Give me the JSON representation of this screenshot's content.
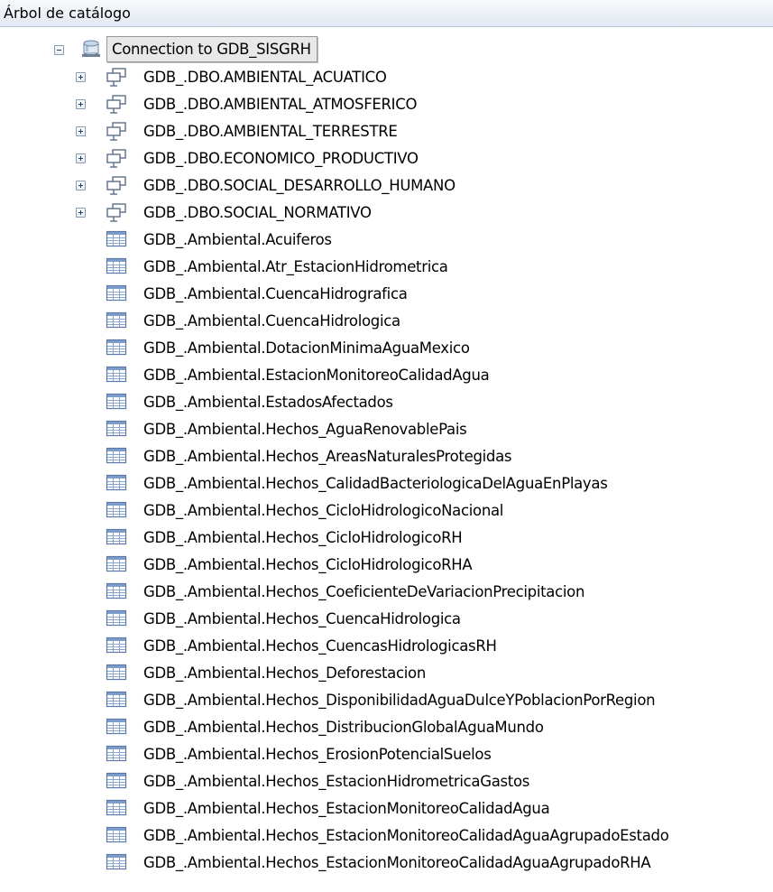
{
  "panel": {
    "title": "Árbol de catálogo"
  },
  "tree": {
    "root": {
      "label": "Connection to GDB_SISGRH",
      "icon": "database-connection-icon",
      "expanded": true
    },
    "datasets": [
      {
        "label": "GDB_.DBO.AMBIENTAL_ACUATICO",
        "icon": "feature-dataset-icon",
        "expanded": false
      },
      {
        "label": "GDB_.DBO.AMBIENTAL_ATMOSFERICO",
        "icon": "feature-dataset-icon",
        "expanded": false
      },
      {
        "label": "GDB_.DBO.AMBIENTAL_TERRESTRE",
        "icon": "feature-dataset-icon",
        "expanded": false
      },
      {
        "label": "GDB_.DBO.ECONOMICO_PRODUCTIVO",
        "icon": "feature-dataset-icon",
        "expanded": false
      },
      {
        "label": "GDB_.DBO.SOCIAL_DESARROLLO_HUMANO",
        "icon": "feature-dataset-icon",
        "expanded": false
      },
      {
        "label": "GDB_.DBO.SOCIAL_NORMATIVO",
        "icon": "feature-dataset-icon",
        "expanded": false
      }
    ],
    "tables": [
      {
        "label": "GDB_.Ambiental.Acuiferos",
        "icon": "table-icon"
      },
      {
        "label": "GDB_.Ambiental.Atr_EstacionHidrometrica",
        "icon": "table-icon"
      },
      {
        "label": "GDB_.Ambiental.CuencaHidrografica",
        "icon": "table-icon"
      },
      {
        "label": "GDB_.Ambiental.CuencaHidrologica",
        "icon": "table-icon"
      },
      {
        "label": "GDB_.Ambiental.DotacionMinimaAguaMexico",
        "icon": "table-icon"
      },
      {
        "label": "GDB_.Ambiental.EstacionMonitoreoCalidadAgua",
        "icon": "table-icon"
      },
      {
        "label": "GDB_.Ambiental.EstadosAfectados",
        "icon": "table-icon"
      },
      {
        "label": "GDB_.Ambiental.Hechos_AguaRenovablePais",
        "icon": "table-icon"
      },
      {
        "label": "GDB_.Ambiental.Hechos_AreasNaturalesProtegidas",
        "icon": "table-icon"
      },
      {
        "label": "GDB_.Ambiental.Hechos_CalidadBacteriologicaDelAguaEnPlayas",
        "icon": "table-icon"
      },
      {
        "label": "GDB_.Ambiental.Hechos_CicloHidrologicoNacional",
        "icon": "table-icon"
      },
      {
        "label": "GDB_.Ambiental.Hechos_CicloHidrologicoRH",
        "icon": "table-icon"
      },
      {
        "label": "GDB_.Ambiental.Hechos_CicloHidrologicoRHA",
        "icon": "table-icon"
      },
      {
        "label": "GDB_.Ambiental.Hechos_CoeficienteDeVariacionPrecipitacion",
        "icon": "table-icon"
      },
      {
        "label": "GDB_.Ambiental.Hechos_CuencaHidrologica",
        "icon": "table-icon"
      },
      {
        "label": "GDB_.Ambiental.Hechos_CuencasHidrologicasRH",
        "icon": "table-icon"
      },
      {
        "label": "GDB_.Ambiental.Hechos_Deforestacion",
        "icon": "table-icon"
      },
      {
        "label": "GDB_.Ambiental.Hechos_DisponibilidadAguaDulceYPoblacionPorRegion",
        "icon": "table-icon"
      },
      {
        "label": "GDB_.Ambiental.Hechos_DistribucionGlobalAguaMundo",
        "icon": "table-icon"
      },
      {
        "label": "GDB_.Ambiental.Hechos_ErosionPotencialSuelos",
        "icon": "table-icon"
      },
      {
        "label": "GDB_.Ambiental.Hechos_EstacionHidrometricaGastos",
        "icon": "table-icon"
      },
      {
        "label": "GDB_.Ambiental.Hechos_EstacionMonitoreoCalidadAgua",
        "icon": "table-icon"
      },
      {
        "label": "GDB_.Ambiental.Hechos_EstacionMonitoreoCalidadAguaAgrupadoEstado",
        "icon": "table-icon"
      },
      {
        "label": "GDB_.Ambiental.Hechos_EstacionMonitoreoCalidadAguaAgrupadoRHA",
        "icon": "table-icon"
      }
    ]
  }
}
